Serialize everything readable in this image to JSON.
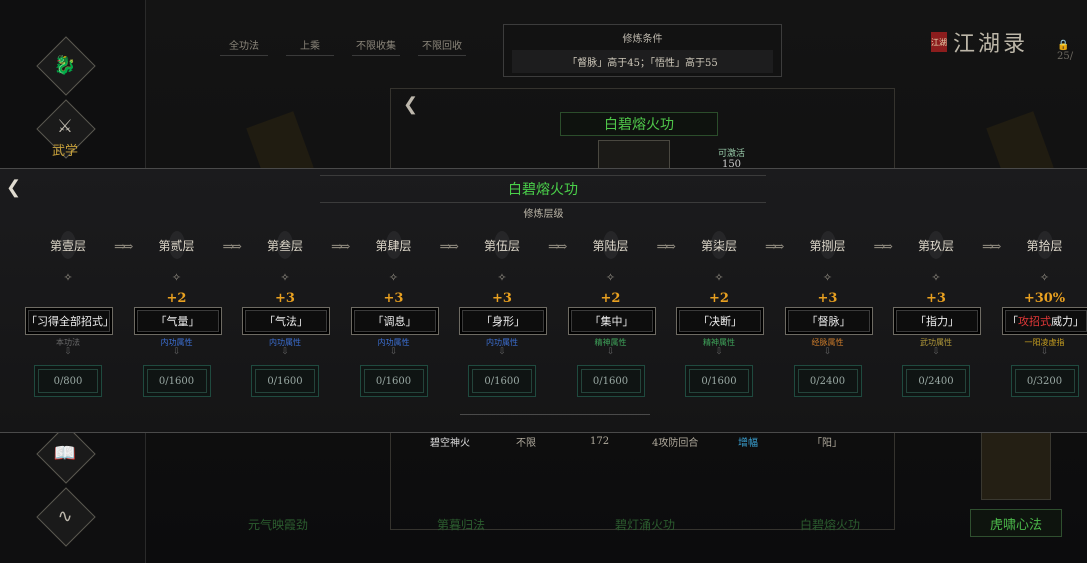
{
  "sidebar": {
    "wuxue_label": "武学"
  },
  "filters": [
    "全功法",
    "上乘",
    "不限收集",
    "不限回收"
  ],
  "condition": {
    "title": "修炼条件",
    "value": "「督脉」高于45；「悟性」高于55"
  },
  "header": {
    "seal": "江湖",
    "title": "江湖录",
    "lock_text": "25/"
  },
  "background": {
    "skill_title": "白碧熔火功",
    "stat_label": "可激活",
    "stat_value": "150",
    "row": {
      "name": "碧空神火",
      "limit": "不限",
      "num": "172",
      "desc": "4攻防回合",
      "effect": "增幅",
      "attr": "「阳」"
    },
    "bottom_labels": [
      "元气映霞劲",
      "第暮归法",
      "碧灯涌火功",
      "白碧熔火功"
    ],
    "right_label": "虎啸心法"
  },
  "modal": {
    "title": "白碧熔火功",
    "subtitle": "修炼层级",
    "levels": [
      {
        "name": "第壹层",
        "bonus": "",
        "attr": "「习得全部招式」",
        "tag": "本功法",
        "tag_color": "#6b6b6b",
        "progress": "0/800"
      },
      {
        "name": "第贰层",
        "bonus": "+2",
        "attr": "「气量」",
        "tag": "内功属性",
        "tag_color": "#3c6fd1",
        "progress": "0/1600"
      },
      {
        "name": "第叁层",
        "bonus": "+3",
        "attr": "「气法」",
        "tag": "内功属性",
        "tag_color": "#3c6fd1",
        "progress": "0/1600"
      },
      {
        "name": "第肆层",
        "bonus": "+3",
        "attr": "「调息」",
        "tag": "内功属性",
        "tag_color": "#3c6fd1",
        "progress": "0/1600"
      },
      {
        "name": "第伍层",
        "bonus": "+3",
        "attr": "「身形」",
        "tag": "内功属性",
        "tag_color": "#3c6fd1",
        "progress": "0/1600"
      },
      {
        "name": "第陆层",
        "bonus": "+2",
        "attr": "「集中」",
        "tag": "精神属性",
        "tag_color": "#3fa35a",
        "progress": "0/1600"
      },
      {
        "name": "第柒层",
        "bonus": "+2",
        "attr": "「决断」",
        "tag": "精神属性",
        "tag_color": "#3fa35a",
        "progress": "0/1600"
      },
      {
        "name": "第捌层",
        "bonus": "+3",
        "attr": "「督脉」",
        "tag": "经脉属性",
        "tag_color": "#c97a2a",
        "progress": "0/2400"
      },
      {
        "name": "第玖层",
        "bonus": "+3",
        "attr": "「指力」",
        "tag": "武功属性",
        "tag_color": "#b39a3a",
        "progress": "0/2400"
      },
      {
        "name": "第拾层",
        "bonus": "+30%",
        "attr_red": "攻招式",
        "attr_rest": "威力」",
        "attr_open": "「",
        "tag": "一阳凌虚指",
        "tag_color": "#c8a020",
        "progress": "0/3200"
      }
    ]
  }
}
